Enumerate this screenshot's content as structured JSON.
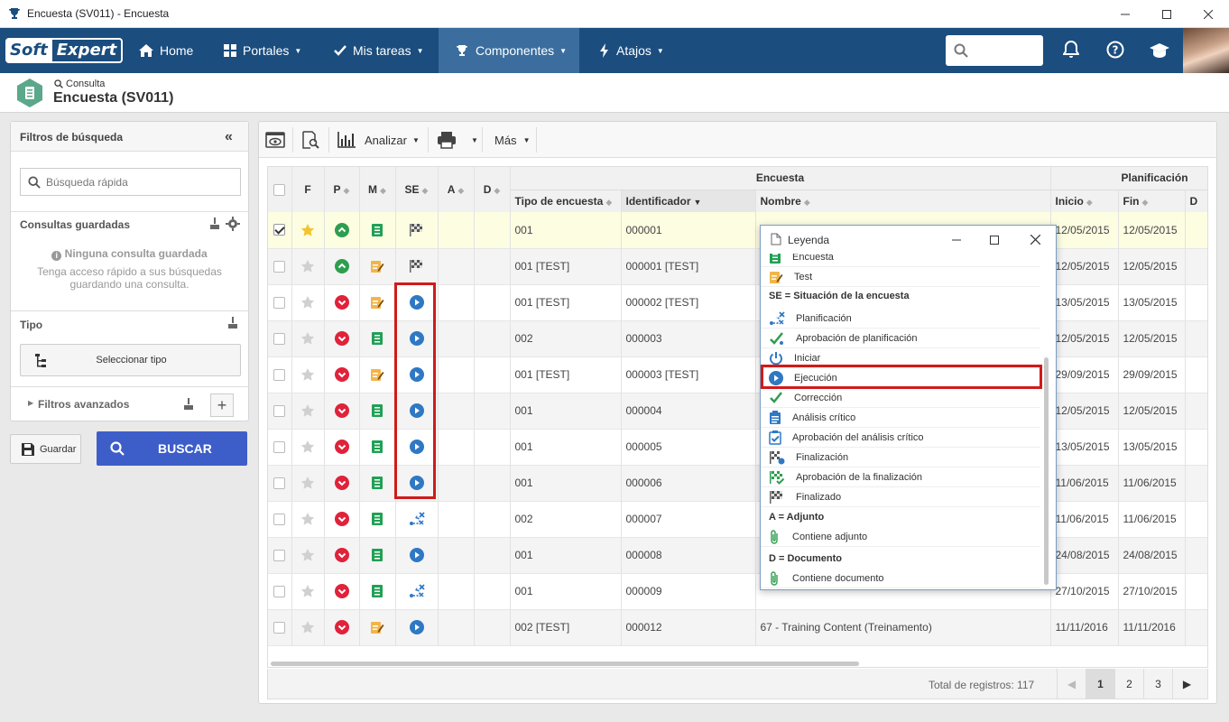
{
  "window": {
    "title": "Encuesta (SV011) - Encuesta"
  },
  "nav": {
    "logo_a": "Soft",
    "logo_b": "Expert",
    "items": [
      {
        "label": "Home",
        "icon": "home-icon"
      },
      {
        "label": "Portales",
        "icon": "grid-icon"
      },
      {
        "label": "Mis tareas",
        "icon": "check-icon"
      },
      {
        "label": "Componentes",
        "icon": "trophy-icon"
      },
      {
        "label": "Atajos",
        "icon": "bolt-icon"
      }
    ]
  },
  "breadcrumb": {
    "small": "Consulta",
    "title": "Encuesta (SV011)"
  },
  "filters": {
    "title": "Filtros de búsqueda",
    "quick_search_placeholder": "Búsqueda rápida",
    "saved_title": "Consultas guardadas",
    "saved_empty": "Ninguna consulta guardada",
    "saved_hint1": "Tenga acceso rápido a sus búsquedas",
    "saved_hint2": "guardando una consulta.",
    "type_title": "Tipo",
    "select_type": "Seleccionar tipo",
    "advanced": "Filtros avanzados",
    "save": "Guardar",
    "search": "BUSCAR"
  },
  "toolbar": {
    "analyze": "Analizar",
    "more": "Más"
  },
  "table": {
    "group_encuesta": "Encuesta",
    "group_plan": "Planificación",
    "cols": {
      "f": "F",
      "p": "P",
      "m": "M",
      "se": "SE",
      "a": "A",
      "d": "D",
      "tipo": "Tipo de encuesta",
      "id": "Identificador",
      "nombre": "Nombre",
      "inicio": "Inicio",
      "fin": "Fin",
      "d2": "D"
    },
    "rows": [
      {
        "checked": true,
        "star": true,
        "p": "up",
        "m": "list",
        "se": "done",
        "tipo": "001",
        "id": "000001",
        "nombre": "",
        "inicio": "12/05/2015",
        "fin": "12/05/2015"
      },
      {
        "checked": false,
        "star": false,
        "p": "up",
        "m": "edit",
        "se": "done",
        "tipo": "001 [TEST]",
        "id": "000001 [TEST]",
        "nombre": "",
        "inicio": "12/05/2015",
        "fin": "12/05/2015"
      },
      {
        "checked": false,
        "star": false,
        "p": "down",
        "m": "edit",
        "se": "exec",
        "tipo": "001 [TEST]",
        "id": "000002 [TEST]",
        "nombre": "",
        "inicio": "13/05/2015",
        "fin": "13/05/2015"
      },
      {
        "checked": false,
        "star": false,
        "p": "down",
        "m": "list",
        "se": "exec",
        "tipo": "002",
        "id": "000003",
        "nombre": "",
        "inicio": "12/05/2015",
        "fin": "12/05/2015"
      },
      {
        "checked": false,
        "star": false,
        "p": "down",
        "m": "edit",
        "se": "exec",
        "tipo": "001 [TEST]",
        "id": "000003 [TEST]",
        "nombre": "",
        "inicio": "29/09/2015",
        "fin": "29/09/2015"
      },
      {
        "checked": false,
        "star": false,
        "p": "down",
        "m": "list",
        "se": "exec",
        "tipo": "001",
        "id": "000004",
        "nombre": "",
        "inicio": "12/05/2015",
        "fin": "12/05/2015"
      },
      {
        "checked": false,
        "star": false,
        "p": "down",
        "m": "list",
        "se": "exec",
        "tipo": "001",
        "id": "000005",
        "nombre": "",
        "inicio": "13/05/2015",
        "fin": "13/05/2015"
      },
      {
        "checked": false,
        "star": false,
        "p": "down",
        "m": "list",
        "se": "exec",
        "tipo": "001",
        "id": "000006",
        "nombre": "",
        "inicio": "11/06/2015",
        "fin": "11/06/2015"
      },
      {
        "checked": false,
        "star": false,
        "p": "down",
        "m": "list",
        "se": "plan",
        "tipo": "002",
        "id": "000007",
        "nombre": "",
        "inicio": "11/06/2015",
        "fin": "11/06/2015"
      },
      {
        "checked": false,
        "star": false,
        "p": "down",
        "m": "list",
        "se": "exec",
        "tipo": "001",
        "id": "000008",
        "nombre": "",
        "inicio": "24/08/2015",
        "fin": "24/08/2015"
      },
      {
        "checked": false,
        "star": false,
        "p": "down",
        "m": "list",
        "se": "plan",
        "tipo": "001",
        "id": "000009",
        "nombre": "",
        "inicio": "27/10/2015",
        "fin": "27/10/2015"
      },
      {
        "checked": false,
        "star": false,
        "p": "down",
        "m": "edit",
        "se": "exec",
        "tipo": "002 [TEST]",
        "id": "000012",
        "nombre": "67 - Training Content (Treinamento)",
        "inicio": "11/11/2016",
        "fin": "11/11/2016"
      }
    ]
  },
  "footer": {
    "total": "Total de registros: 117",
    "pages": [
      "1",
      "2",
      "3"
    ],
    "current": "1"
  },
  "legend": {
    "title": "Leyenda",
    "items_top": [
      {
        "label": "Encuesta"
      },
      {
        "label": "Test"
      }
    ],
    "se_title": "SE = Situación de la encuesta",
    "se_items": [
      {
        "label": "Planificación"
      },
      {
        "label": "Aprobación de planificación"
      },
      {
        "label": "Iniciar"
      },
      {
        "label": "Ejecución"
      },
      {
        "label": "Corrección"
      },
      {
        "label": "Análisis crítico"
      },
      {
        "label": "Aprobación del análisis crítico"
      },
      {
        "label": "Finalización"
      },
      {
        "label": "Aprobación de la finalización"
      },
      {
        "label": "Finalizado"
      }
    ],
    "a_title": "A = Adjunto",
    "a_item": "Contiene adjunto",
    "d_title": "D = Documento",
    "d_item": "Contiene documento"
  },
  "colors": {
    "nav": "#1b4d7e",
    "nav_active": "#3b6e9e",
    "search_btn": "#3d5ec9",
    "highlight": "#d11a1a",
    "selected_row": "#fdfde2"
  }
}
